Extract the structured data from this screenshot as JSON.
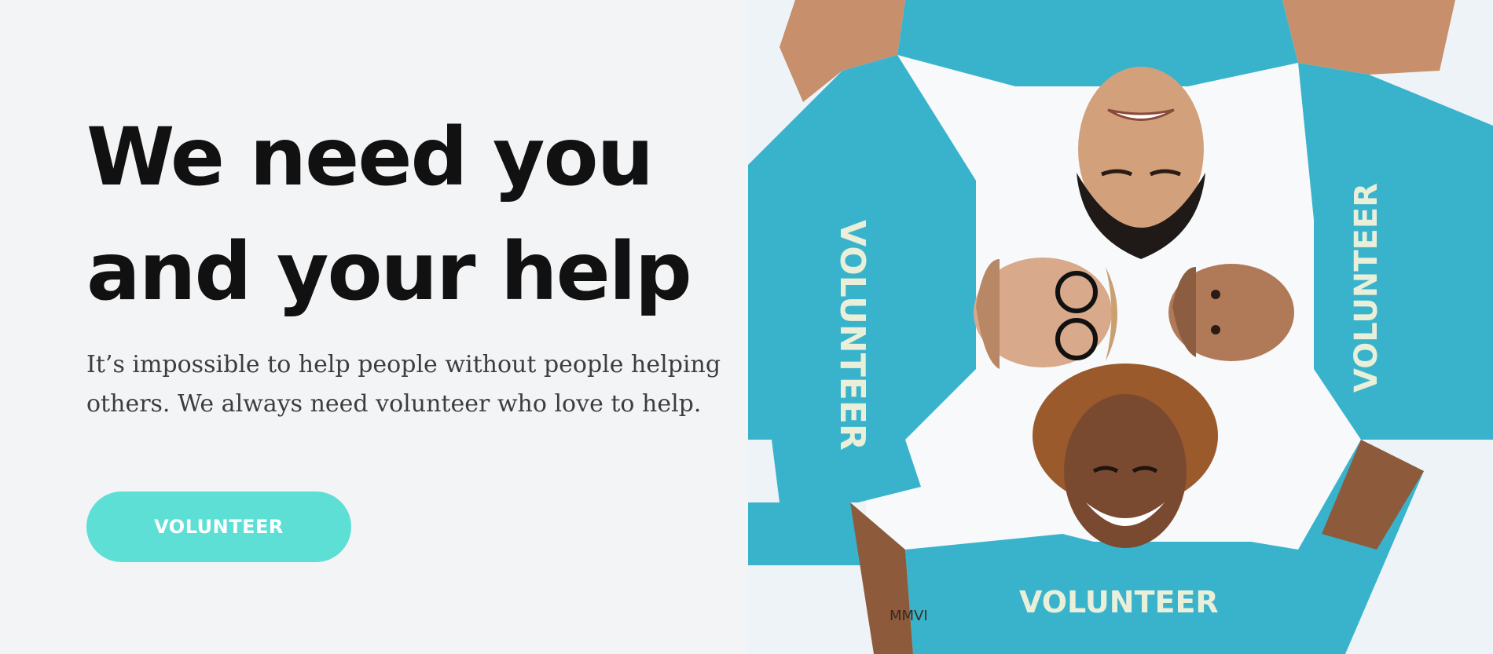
{
  "hero": {
    "headline_line1": "We need you",
    "headline_line2": "and your help",
    "subtext_line1": "It’s impossible to help people without people helping",
    "subtext_line2": "others. We always need volunteer who love to help.",
    "button_label": "VOLUNTEER"
  },
  "photo": {
    "shirt_text": "VOLUNTEER",
    "shirt_text_bottom": "VOLUNTEER",
    "tattoo_text": "MMVI"
  },
  "colors": {
    "background": "#f3f4f6",
    "headline": "#111111",
    "body_text": "#3d3d3d",
    "button": "#5ddfd6",
    "button_text": "#ffffff",
    "shirt": "#39b3cc",
    "sky": "#eef3f7"
  }
}
